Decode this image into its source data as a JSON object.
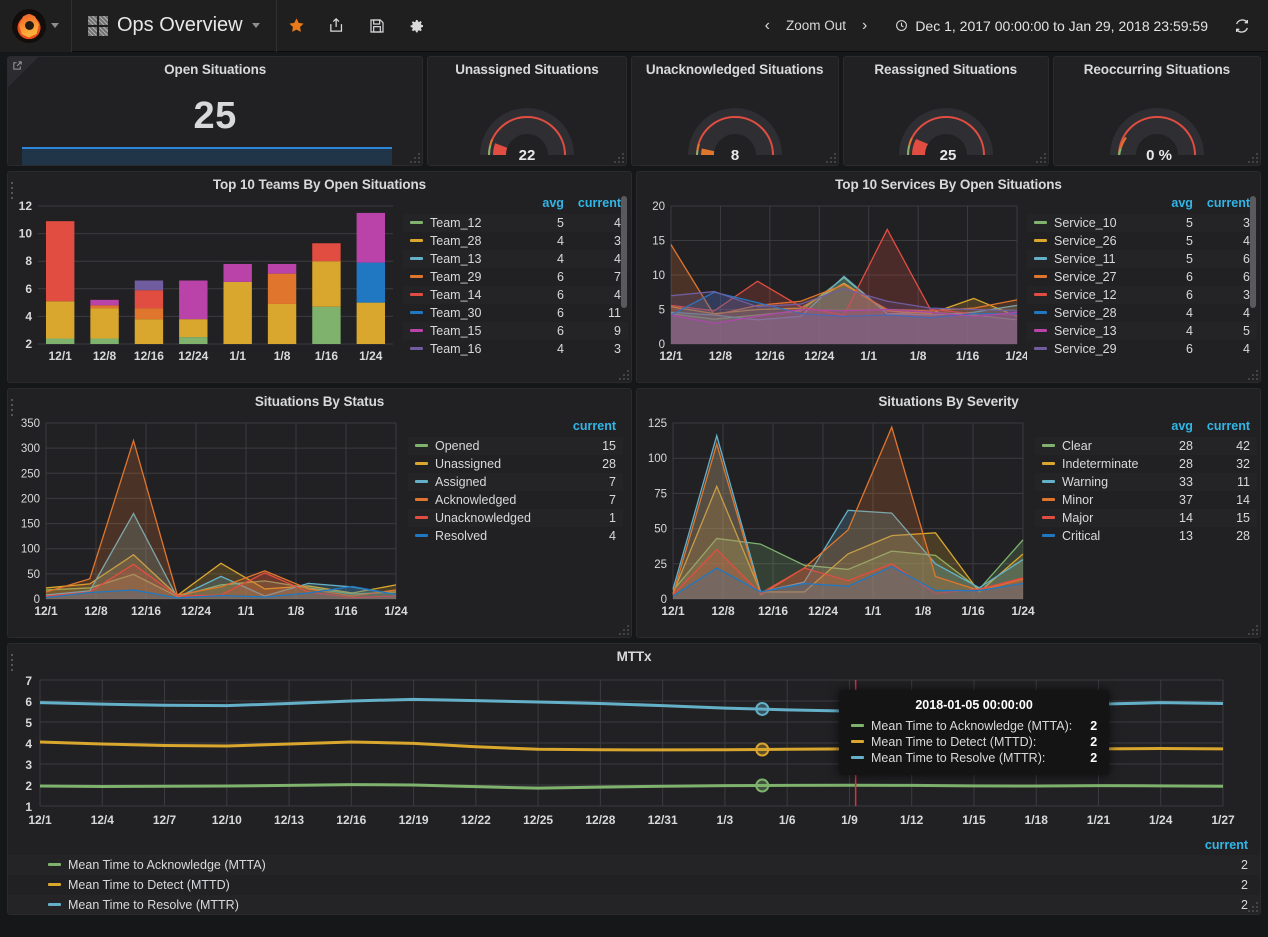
{
  "navbar": {
    "logo_icon": "grafana-logo-icon",
    "dashboard_icon": "dashboard-grid-icon",
    "dashboard_title": "Ops Overview",
    "actions": [
      {
        "name": "star-icon",
        "label": "Mark as favorite"
      },
      {
        "name": "share-icon",
        "label": "Share dashboard"
      },
      {
        "name": "save-icon",
        "label": "Save dashboard"
      },
      {
        "name": "gear-icon",
        "label": "Dashboard settings"
      }
    ],
    "zoom_out_label": "Zoom Out",
    "prev_arrow": "‹",
    "next_arrow": "›",
    "time_range": "Dec 1, 2017 00:00:00 to Jan 29, 2018 23:59:59",
    "clock_icon": "clock-icon",
    "refresh_icon": "refresh-icon"
  },
  "stats": {
    "open_situations": {
      "title": "Open Situations",
      "value": "25",
      "sparkline_color": "#2e86d8"
    },
    "gauges": [
      {
        "title": "Unassigned Situations",
        "value": "22",
        "fill_pct": 0.22,
        "fill_color": "#e24d42"
      },
      {
        "title": "Unacknowledged Situations",
        "value": "8",
        "fill_pct": 0.08,
        "fill_color": "#e0752d"
      },
      {
        "title": "Reassigned Situations",
        "value": "25",
        "fill_pct": 0.25,
        "fill_color": "#e24d42"
      },
      {
        "title": "Reoccurring Situations",
        "value": "0 %",
        "fill_pct": 0.0,
        "fill_color": "#7eb26d"
      }
    ]
  },
  "chart_data": [
    {
      "id": "top10teams",
      "type": "bar",
      "title": "Top 10 Teams By Open Situations",
      "stacked": true,
      "ylabel": "",
      "xlabel": "",
      "ylim": [
        2,
        12
      ],
      "yticks": [
        2,
        4,
        6,
        8,
        10,
        12
      ],
      "grid": true,
      "categories": [
        "12/1",
        "12/8",
        "12/16",
        "12/24",
        "1/1",
        "1/8",
        "1/16",
        "1/24"
      ],
      "legend_columns": [
        "avg",
        "current"
      ],
      "series": [
        {
          "name": "Team_12",
          "color": "#7eb26d",
          "avg": 5,
          "current": 4,
          "values": [
            0.4,
            0.4,
            0.0,
            0.5,
            0.0,
            0.0,
            2.7,
            0.0
          ]
        },
        {
          "name": "Team_28",
          "color": "#d9a62e",
          "avg": 4,
          "current": 3,
          "values": [
            2.7,
            2.2,
            1.8,
            1.3,
            4.5,
            2.9,
            3.3,
            3.0
          ]
        },
        {
          "name": "Team_13",
          "color": "#64b0c8",
          "avg": 4,
          "current": 4,
          "values": [
            0.0,
            0.0,
            0.0,
            0.0,
            0.0,
            0.0,
            0.0,
            0.0
          ]
        },
        {
          "name": "Team_29",
          "color": "#e0752d",
          "avg": 6,
          "current": 7,
          "values": [
            0.0,
            0.2,
            0.8,
            0.0,
            0.0,
            2.2,
            0.0,
            0.0
          ]
        },
        {
          "name": "Team_14",
          "color": "#e24d42",
          "avg": 6,
          "current": 4,
          "values": [
            5.8,
            0.0,
            1.3,
            0.0,
            0.0,
            0.0,
            1.3,
            0.0
          ]
        },
        {
          "name": "Team_30",
          "color": "#1f78c1",
          "avg": 6,
          "current": 11,
          "values": [
            0.0,
            0.0,
            0.0,
            0.0,
            0.0,
            0.0,
            0.0,
            2.9
          ]
        },
        {
          "name": "Team_15",
          "color": "#ba43a9",
          "avg": 6,
          "current": 9,
          "values": [
            0.0,
            0.4,
            0.0,
            2.8,
            1.3,
            0.7,
            0.0,
            3.6
          ]
        },
        {
          "name": "Team_16",
          "color": "#705da0",
          "avg": 4,
          "current": 3,
          "values": [
            0.0,
            0.0,
            0.7,
            0.0,
            0.0,
            0.0,
            0.0,
            0.0
          ]
        }
      ],
      "bar_totals": [
        10.8,
        5.6,
        6.6,
        6.6,
        7.8,
        7.9,
        9.3,
        11.5
      ]
    },
    {
      "id": "top10services",
      "type": "area",
      "title": "Top 10 Services By Open Situations",
      "ylim": [
        0,
        20
      ],
      "yticks": [
        0,
        5,
        10,
        15,
        20
      ],
      "grid": true,
      "categories": [
        "12/1",
        "12/8",
        "12/16",
        "12/24",
        "1/1",
        "1/8",
        "1/16",
        "1/24"
      ],
      "legend_columns": [
        "avg",
        "current"
      ],
      "series": [
        {
          "name": "Service_10",
          "color": "#7eb26d",
          "avg": 5,
          "current": 3,
          "values": [
            4.4,
            3.6,
            4.2,
            4.8,
            9.6,
            4.4,
            4.6,
            4.2,
            3.5
          ]
        },
        {
          "name": "Service_26",
          "color": "#d9a62e",
          "avg": 5,
          "current": 4,
          "values": [
            5.4,
            4.4,
            5.0,
            5.2,
            8.8,
            4.8,
            4.4,
            6.6,
            4.0
          ]
        },
        {
          "name": "Service_11",
          "color": "#64b0c8",
          "avg": 5,
          "current": 6,
          "values": [
            4.6,
            4.2,
            3.5,
            4.0,
            9.8,
            4.4,
            4.2,
            4.6,
            5.6
          ]
        },
        {
          "name": "Service_27",
          "color": "#e0752d",
          "avg": 6,
          "current": 6,
          "values": [
            14.4,
            4.2,
            5.6,
            6.2,
            8.6,
            5.0,
            4.8,
            5.2,
            6.4
          ]
        },
        {
          "name": "Service_12",
          "color": "#e24d42",
          "avg": 6,
          "current": 3,
          "values": [
            5.6,
            4.8,
            9.1,
            5.4,
            4.2,
            16.6,
            5.0,
            4.4,
            4.2
          ]
        },
        {
          "name": "Service_28",
          "color": "#1f78c1",
          "avg": 4,
          "current": 4,
          "values": [
            4.2,
            7.5,
            6.0,
            4.4,
            4.0,
            4.2,
            3.8,
            4.4,
            4.4
          ]
        },
        {
          "name": "Service_13",
          "color": "#ba43a9",
          "avg": 4,
          "current": 5,
          "values": [
            4.2,
            3.0,
            4.0,
            5.0,
            4.8,
            5.0,
            4.6,
            4.0,
            4.6
          ]
        },
        {
          "name": "Service_29",
          "color": "#705da0",
          "avg": 6,
          "current": 4,
          "values": [
            7.0,
            7.6,
            5.4,
            5.8,
            8.0,
            6.2,
            5.2,
            5.0,
            4.8
          ]
        }
      ]
    },
    {
      "id": "situations_by_status",
      "type": "area",
      "title": "Situations By Status",
      "ylim": [
        0,
        350
      ],
      "yticks": [
        0,
        50,
        100,
        150,
        200,
        250,
        300,
        350
      ],
      "grid": true,
      "categories": [
        "12/1",
        "12/8",
        "12/16",
        "12/24",
        "1/1",
        "1/8",
        "1/16",
        "1/24"
      ],
      "legend_columns": [
        "current"
      ],
      "series": [
        {
          "name": "Opened",
          "color": "#7eb26d",
          "current": 15,
          "values": [
            18,
            22,
            49,
            5,
            28,
            36,
            22,
            10,
            14
          ]
        },
        {
          "name": "Unassigned",
          "color": "#d9a62e",
          "current": 28,
          "values": [
            22,
            30,
            88,
            7,
            71,
            20,
            26,
            12,
            28
          ]
        },
        {
          "name": "Assigned",
          "color": "#64b0c8",
          "current": 7,
          "values": [
            8,
            16,
            170,
            3,
            45,
            6,
            31,
            24,
            9
          ]
        },
        {
          "name": "Acknowledged",
          "color": "#e0752d",
          "current": 7,
          "values": [
            14,
            40,
            315,
            8,
            24,
            56,
            20,
            6,
            18
          ]
        },
        {
          "name": "Unacknowledged",
          "color": "#e24d42",
          "current": 1,
          "values": [
            6,
            14,
            69,
            6,
            8,
            52,
            14,
            3,
            6
          ]
        },
        {
          "name": "Resolved",
          "color": "#1f78c1",
          "current": 4,
          "values": [
            3,
            13,
            18,
            2,
            7,
            4,
            12,
            25,
            9
          ]
        }
      ]
    },
    {
      "id": "situations_by_severity",
      "type": "area",
      "title": "Situations By Severity",
      "ylim": [
        0,
        125
      ],
      "yticks": [
        0,
        25,
        50,
        75,
        100,
        125
      ],
      "grid": true,
      "categories": [
        "12/1",
        "12/8",
        "12/16",
        "12/24",
        "1/1",
        "1/8",
        "1/16",
        "1/24"
      ],
      "legend_columns": [
        "avg",
        "current"
      ],
      "series": [
        {
          "name": "Clear",
          "color": "#7eb26d",
          "avg": 28,
          "current": 42,
          "values": [
            6,
            43,
            39,
            24,
            21,
            34,
            31,
            7,
            42
          ]
        },
        {
          "name": "Indeterminate",
          "color": "#d9a62e",
          "avg": 28,
          "current": 32,
          "values": [
            4,
            80,
            5,
            5,
            32,
            45,
            47,
            5,
            32
          ]
        },
        {
          "name": "Warning",
          "color": "#64b0c8",
          "avg": 33,
          "current": 11,
          "values": [
            7,
            116,
            5,
            12,
            63,
            61,
            25,
            8,
            28
          ]
        },
        {
          "name": "Minor",
          "color": "#e0752d",
          "avg": 37,
          "current": 14,
          "values": [
            3,
            110,
            3,
            22,
            49,
            122,
            16,
            6,
            14
          ]
        },
        {
          "name": "Major",
          "color": "#e24d42",
          "avg": 14,
          "current": 15,
          "values": [
            3,
            35,
            4,
            22,
            13,
            25,
            4,
            7,
            15
          ]
        },
        {
          "name": "Critical",
          "color": "#1f78c1",
          "avg": 13,
          "current": 28,
          "values": [
            2,
            22,
            5,
            11,
            9,
            23,
            6,
            6,
            11
          ]
        }
      ]
    },
    {
      "id": "mttx",
      "type": "line",
      "title": "MTTx",
      "ylim": [
        1,
        7
      ],
      "yticks": [
        1,
        2,
        3,
        4,
        5,
        6,
        7
      ],
      "grid": true,
      "xticks": [
        "12/1",
        "12/4",
        "12/7",
        "12/10",
        "12/13",
        "12/16",
        "12/19",
        "12/22",
        "12/25",
        "12/28",
        "12/31",
        "1/3",
        "1/6",
        "1/9",
        "1/12",
        "1/15",
        "1/18",
        "1/21",
        "1/24",
        "1/27"
      ],
      "legend_columns": [
        "current"
      ],
      "series": [
        {
          "name": "Mean Time to Acknowledge (MTTA)",
          "color": "#7eb26d",
          "current": 2,
          "values": [
            1.95,
            1.93,
            1.94,
            1.95,
            1.98,
            2.02,
            2.0,
            1.92,
            1.85,
            1.9,
            1.94,
            1.97,
            1.98,
            1.99,
            1.98,
            1.96,
            1.95,
            1.97,
            1.96,
            1.94
          ]
        },
        {
          "name": "Mean Time to Detect (MTTD)",
          "color": "#d9a62e",
          "current": 2,
          "values": [
            4.05,
            3.95,
            3.88,
            3.86,
            3.95,
            4.05,
            3.98,
            3.82,
            3.7,
            3.68,
            3.67,
            3.68,
            3.7,
            3.72,
            3.7,
            3.68,
            3.7,
            3.72,
            3.74,
            3.72
          ]
        },
        {
          "name": "Mean Time to Resolve (MTTR)",
          "color": "#64b0c8",
          "current": 2,
          "values": [
            5.92,
            5.85,
            5.8,
            5.78,
            5.88,
            6.0,
            6.08,
            6.02,
            5.95,
            5.88,
            5.78,
            5.66,
            5.58,
            5.52,
            5.5,
            5.55,
            5.7,
            5.85,
            5.92,
            5.88
          ]
        }
      ],
      "tooltip": {
        "timestamp": "2018-01-05 00:00:00",
        "rows": [
          {
            "name": "Mean Time to Acknowledge (MTTA):",
            "value": "2",
            "color": "#7eb26d"
          },
          {
            "name": "Mean Time to Detect (MTTD):",
            "value": "2",
            "color": "#d9a62e"
          },
          {
            "name": "Mean Time to Resolve (MTTR):",
            "value": "2",
            "color": "#64b0c8"
          }
        ]
      },
      "crosshair_color": "#e02f44"
    }
  ]
}
